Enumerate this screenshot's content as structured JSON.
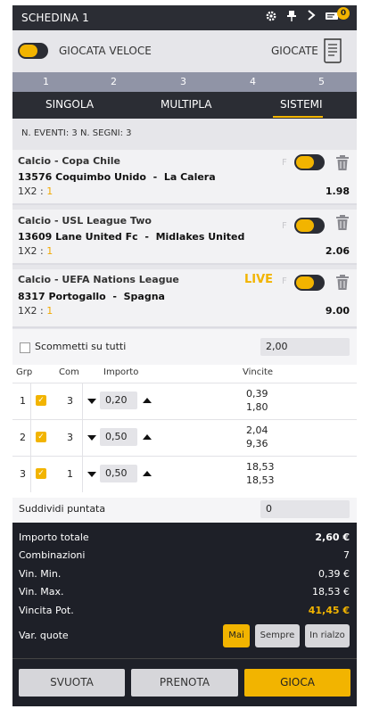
{
  "header": {
    "title": "SCHEDINA 1",
    "badge": "0",
    "icons": [
      "gear-icon",
      "pin-icon",
      "chevron-right-icon",
      "ticket-icon"
    ]
  },
  "quick": {
    "label": "GIOCATA VELOCE",
    "giocate_label": "GIOCATE"
  },
  "steps": [
    "1",
    "2",
    "3",
    "4",
    "5"
  ],
  "tabs": [
    {
      "label": "SINGOLA"
    },
    {
      "label": "MULTIPLA"
    },
    {
      "label": "SISTEMI",
      "active": true
    }
  ],
  "info": "N. EVENTI: 3  N. SEGNI: 3",
  "events": [
    {
      "competition": "Calcio - Copa Chile",
      "code": "13576",
      "home": "Coquimbo Unido",
      "away": "La Calera",
      "market": "1X2 :",
      "selection": "1",
      "odd": "1.98",
      "fixed_label": "F",
      "live": ""
    },
    {
      "competition": "Calcio - USL League Two",
      "code": "13609",
      "home": "Lane United Fc",
      "away": "Midlakes United",
      "market": "1X2 :",
      "selection": "1",
      "odd": "2.06",
      "fixed_label": "F",
      "live": ""
    },
    {
      "competition": "Calcio - UEFA Nations League",
      "code": "8317",
      "home": "Portogallo",
      "away": "Spagna",
      "market": "1X2 :",
      "selection": "1",
      "odd": "9.00",
      "fixed_label": "F",
      "live": "LIVE"
    }
  ],
  "scommetti": {
    "label": "Scommetti su tutti",
    "value": "2,00"
  },
  "systems": {
    "headers": {
      "grp": "Grp",
      "com": "Com",
      "importo": "Importo",
      "vincite": "Vincite"
    },
    "rows": [
      {
        "grp": "1",
        "com": "3",
        "importo": "0,20",
        "vin_min": "0,39",
        "vin_max": "1,80"
      },
      {
        "grp": "2",
        "com": "3",
        "importo": "0,50",
        "vin_min": "2,04",
        "vin_max": "9,36"
      },
      {
        "grp": "3",
        "com": "1",
        "importo": "0,50",
        "vin_min": "18,53",
        "vin_max": "18,53"
      }
    ]
  },
  "suddividi": {
    "label": "Suddividi puntata",
    "value": "0"
  },
  "summary": {
    "importo_label": "Importo totale",
    "importo_value": "2,60 €",
    "comb_label": "Combinazioni",
    "comb_value": "7",
    "vinmin_label": "Vin. Min.",
    "vinmin_value": "0,39 €",
    "vinmax_label": "Vin. Max.",
    "vinmax_value": "18,53 €",
    "vincita_label": "Vincita Pot.",
    "vincita_value": "41,45 €",
    "var_label": "Var. quote",
    "var_options": [
      "Mai",
      "Sempre",
      "In rialzo"
    ]
  },
  "actions": {
    "svuota": "SVUOTA",
    "prenota": "PRENOTA",
    "gioca": "GIOCA"
  },
  "colors": {
    "accent": "#f2b400",
    "dark": "#2b2d34",
    "summary_bg": "#1e2028"
  }
}
